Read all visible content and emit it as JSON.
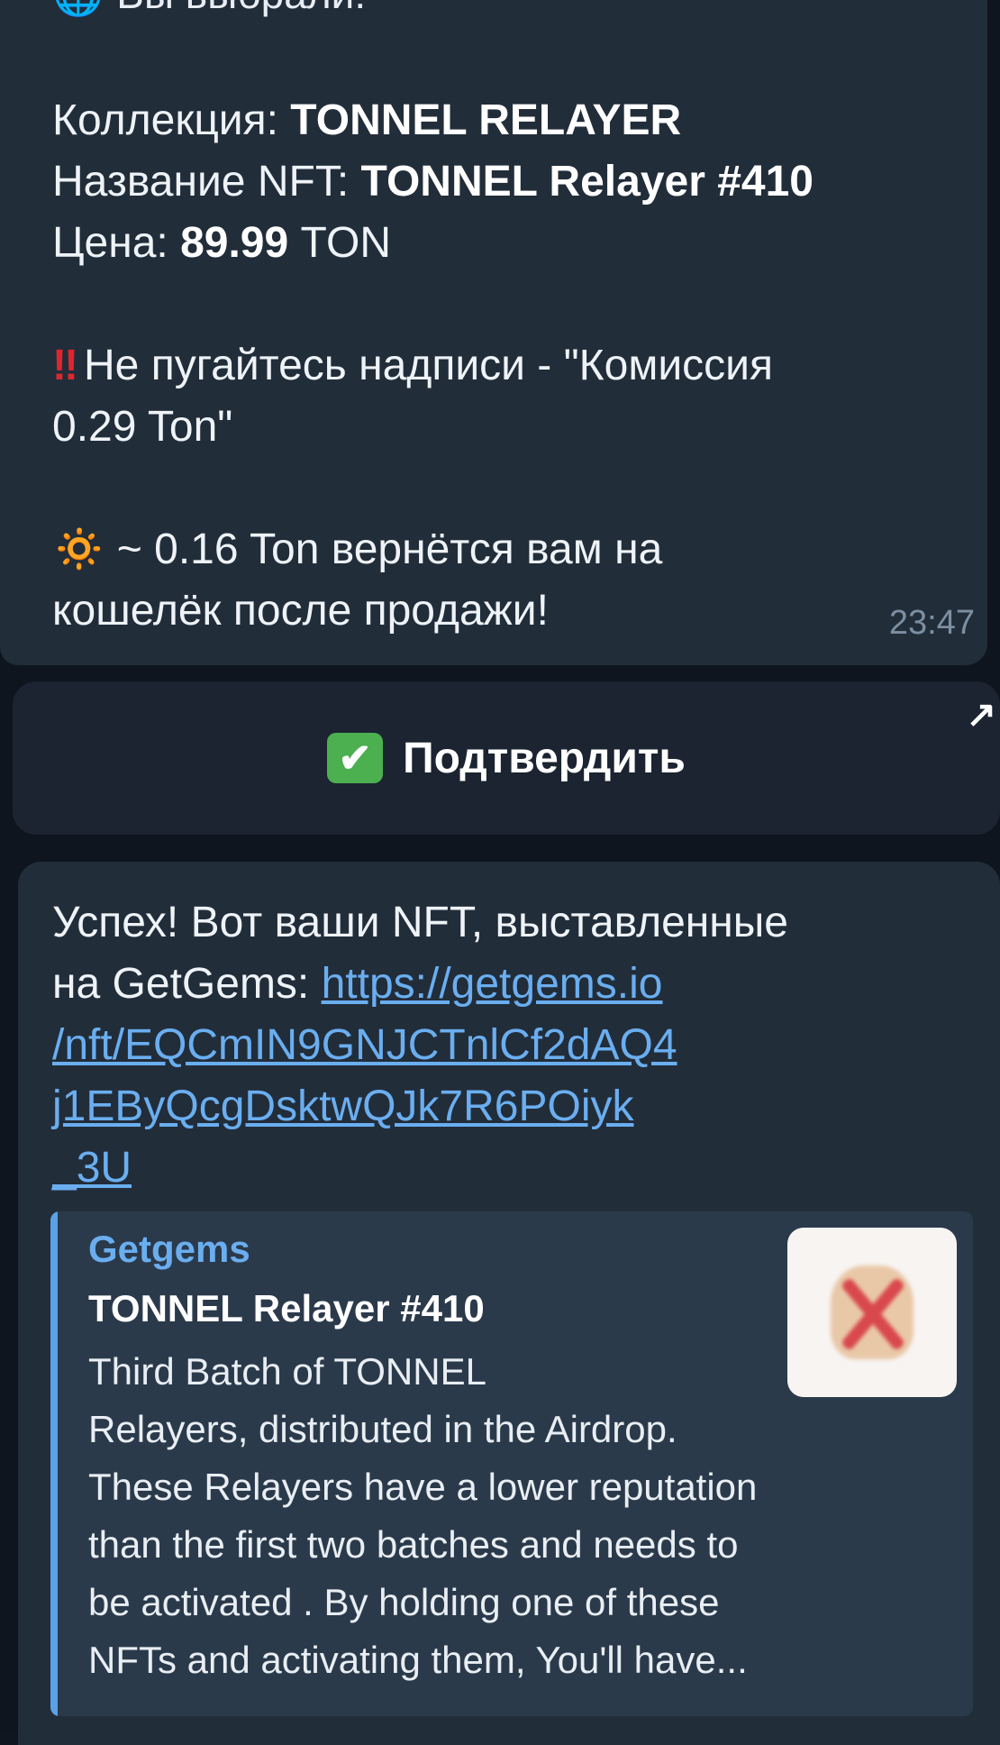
{
  "top_message": {
    "cut_line": "Вы выбрали:",
    "collection_label": "Коллекция: ",
    "collection_value": "TONNEL RELAYER",
    "nft_name_label": "Название NFT: ",
    "nft_name_value": "TONNEL Relayer #410",
    "price_label": "Цена: ",
    "price_value": "89.99",
    "price_unit": " TON",
    "warning_icon": "‼",
    "warning_line1": "Не пугайтесь надписи - \"Комиссия",
    "warning_line2": "0.29 Ton\"",
    "refund_icon": "🔅",
    "refund_line1": "~ 0.16 Ton вернётся вам на",
    "refund_line2": "кошелёк после продажи!",
    "time": "23:47"
  },
  "keyboard": {
    "confirm_icon": "✔",
    "confirm_label": "Подтвердить",
    "corner_arrow": "↗"
  },
  "bottom_message": {
    "line1": "Успех! Вот ваши NFT, выставленные",
    "line2_prefix": "на GetGems: ",
    "link_part1": "https://getgems.io",
    "link_part2": "/nft/EQCmIN9GNJCTnlCf2dAQ4",
    "link_part3": "j1EByQcgDsktwQJk7R6POiyk",
    "link_part4": "_3U",
    "preview": {
      "site": "Getgems",
      "title": "TONNEL Relayer #410",
      "desc_lines": [
        "Third Batch of TONNEL",
        "Relayers, distributed in the Airdrop.",
        "These Relayers have a lower reputation",
        "than the first two batches and needs to",
        "be activated . By holding one of these",
        "NFTs and activating them, You'll have..."
      ]
    }
  },
  "colors": {
    "bubble": "#222d3a",
    "link": "#6aaef0",
    "preview_bar": "#5aa1e6",
    "chat_bg": "#0e151e"
  }
}
